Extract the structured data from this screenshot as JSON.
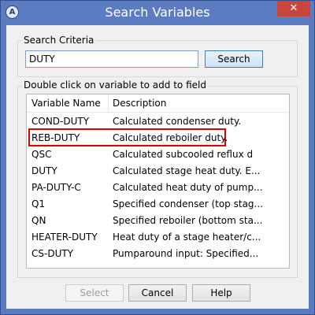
{
  "window": {
    "title": "Search Variables",
    "app_icon": "app-logo-icon",
    "app_icon_glyph": "A",
    "close_glyph": "✕"
  },
  "search": {
    "group_label": "Search Criteria",
    "value": "DUTY",
    "button_label": "Search"
  },
  "results": {
    "group_label": "Double click on variable to add to field",
    "columns": [
      "Variable Name",
      "Description"
    ],
    "rows": [
      {
        "name": "COND-DUTY",
        "description": "Calculated condenser duty."
      },
      {
        "name": "REB-DUTY",
        "description": "Calculated reboiler duty."
      },
      {
        "name": "QSC",
        "description": "Calculated subcooled reflux d"
      },
      {
        "name": "DUTY",
        "description": "Calculated stage heat duty. E..."
      },
      {
        "name": "PA-DUTY-C",
        "description": "Calculated heat duty of pump..."
      },
      {
        "name": "Q1",
        "description": "Specified condenser (top stag..."
      },
      {
        "name": "QN",
        "description": "Specified reboiler (bottom sta..."
      },
      {
        "name": "HEATER-DUTY",
        "description": "Heat duty of a stage heater/c..."
      },
      {
        "name": "CS-DUTY",
        "description": "Pumparound input: Specified..."
      }
    ],
    "highlighted_row": 1
  },
  "footer": {
    "select_label": "Select",
    "cancel_label": "Cancel",
    "help_label": "Help"
  },
  "colors": {
    "title_bar": "#5b7cc0",
    "close_button": "#c7463e",
    "highlight_box": "#e00000"
  }
}
